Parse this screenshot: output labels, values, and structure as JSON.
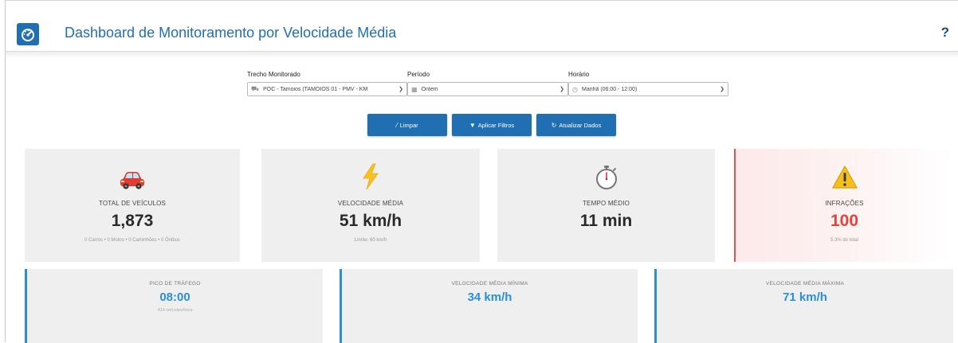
{
  "header": {
    "title": "Dashboard de Monitoramento por Velocidade Média",
    "help": "?",
    "logo_icon": "speedometer-icon",
    "color": "#1f6fb2"
  },
  "filters": {
    "trecho": {
      "label": "Trecho Monitorado",
      "value": "POC - Tamoios (TAMOIOS 01 - PMV - KM",
      "icon": "road-icon"
    },
    "periodo": {
      "label": "Período",
      "value": "Ontem",
      "icon": "calendar-icon"
    },
    "horario": {
      "label": "Horário",
      "value": "Manhã (06:00 - 12:00)",
      "icon": "clock-icon"
    }
  },
  "buttons": {
    "limpar": "Limpar",
    "aplicar": "Aplicar Filtros",
    "atualizar": "Atualizar Dados"
  },
  "cards": {
    "total": {
      "label": "TOTAL DE VEÍCULOS",
      "value": "1,873",
      "sub": "0 Carros • 0 Motos • 0 Caminhões • 0 Ônibus",
      "icon": "car-icon"
    },
    "velocidade": {
      "label": "VELOCIDADE MÉDIA",
      "value": "51 km/h",
      "sub": "Limite: 60 km/h",
      "icon": "lightning-icon"
    },
    "tempo": {
      "label": "TEMPO MÉDIO",
      "value": "11 min",
      "sub": "",
      "icon": "stopwatch-icon"
    },
    "infracoes": {
      "label": "INFRAÇÕES",
      "value": "100",
      "sub": "5.3% do total",
      "icon": "warning-icon",
      "color": "#e8403b"
    }
  },
  "stats": {
    "pico": {
      "label": "PICO DE TRÁFEGO",
      "value": "08:00",
      "sub": "414 veículos/hora"
    },
    "minima": {
      "label": "VELOCIDADE MÉDIA MÍNIMA",
      "value": "34 km/h"
    },
    "maxima": {
      "label": "VELOCIDADE MÉDIA MÁXIMA",
      "value": "71 km/h"
    },
    "accent": "#2a8fd6"
  }
}
